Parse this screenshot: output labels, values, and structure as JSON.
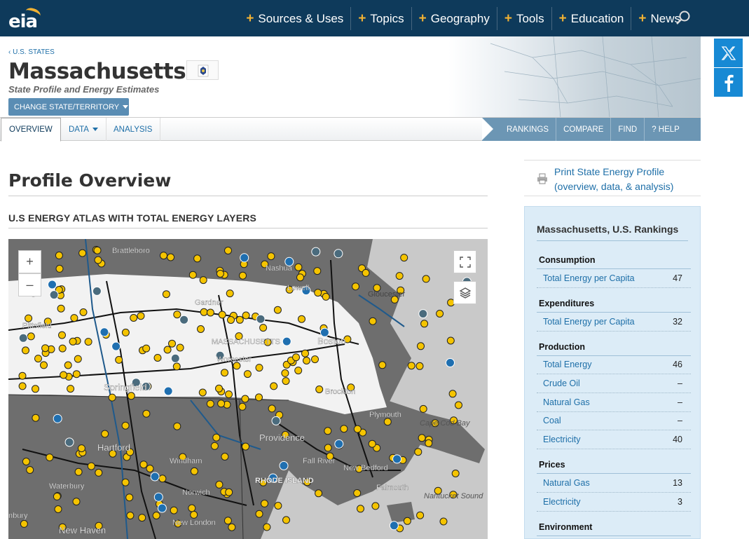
{
  "nav": {
    "logo": "eia",
    "items": [
      {
        "label": "Sources & Uses"
      },
      {
        "label": "Topics"
      },
      {
        "label": "Geography"
      },
      {
        "label": "Tools"
      },
      {
        "label": "Education"
      },
      {
        "label": "News"
      }
    ],
    "plus": "+"
  },
  "header": {
    "breadcrumb": "‹ U.S. STATES",
    "title": "Massachusetts",
    "subtitle": "State Profile and Energy Estimates",
    "change_button": "CHANGE STATE/TERRITORY"
  },
  "tabs": [
    {
      "label": "OVERVIEW"
    },
    {
      "label": "DATA"
    },
    {
      "label": "ANALYSIS"
    }
  ],
  "right_nav": [
    {
      "label": "RANKINGS"
    },
    {
      "label": "COMPARE"
    },
    {
      "label": "FIND"
    },
    {
      "label": "? HELP"
    }
  ],
  "main": {
    "title": "Profile Overview",
    "section": "U.S ENERGY ATLAS WITH TOTAL ENERGY LAYERS"
  },
  "map": {
    "zoom_in": "+",
    "zoom_out": "–",
    "labels": [
      {
        "text": "Brattleboro"
      },
      {
        "text": "Nashua"
      },
      {
        "text": "Lowell"
      },
      {
        "text": "Gloucester"
      },
      {
        "text": "Gardner"
      },
      {
        "text": "Pittsfield"
      },
      {
        "text": "MASSACHUSETTS"
      },
      {
        "text": "Boston"
      },
      {
        "text": "Worcester"
      },
      {
        "text": "Springfield"
      },
      {
        "text": "Brockton"
      },
      {
        "text": "Plymouth"
      },
      {
        "text": "Cape Cod Bay"
      },
      {
        "text": "Hartford"
      },
      {
        "text": "Providence"
      },
      {
        "text": "Windham"
      },
      {
        "text": "Fall River"
      },
      {
        "text": "New Bedford"
      },
      {
        "text": "RHODE ISLAND"
      },
      {
        "text": "Waterbury"
      },
      {
        "text": "Norwich"
      },
      {
        "text": "Falmouth"
      },
      {
        "text": "Nantucket Sound"
      },
      {
        "text": "New London"
      },
      {
        "text": "New Haven"
      },
      {
        "text": "nbury"
      }
    ]
  },
  "sidebar": {
    "print_text": "Print State Energy Profile",
    "print_text2": "(overview, data, & analysis)",
    "rankings_title": "Massachusetts, U.S. Rankings",
    "groups": [
      {
        "name": "Consumption",
        "rows": [
          {
            "label": "Total Energy per Capita",
            "value": "47"
          }
        ]
      },
      {
        "name": "Expenditures",
        "rows": [
          {
            "label": "Total Energy per Capita",
            "value": "32"
          }
        ]
      },
      {
        "name": "Production",
        "rows": [
          {
            "label": "Total Energy",
            "value": "46"
          },
          {
            "label": "Crude Oil",
            "value": "–"
          },
          {
            "label": "Natural Gas",
            "value": "–"
          },
          {
            "label": "Coal",
            "value": "–"
          },
          {
            "label": "Electricity",
            "value": "40"
          }
        ]
      },
      {
        "name": "Prices",
        "rows": [
          {
            "label": "Natural Gas",
            "value": "13"
          },
          {
            "label": "Electricity",
            "value": "3"
          }
        ]
      },
      {
        "name": "Environment",
        "rows": []
      }
    ]
  },
  "colors": {
    "nav_bg": "#0e3a5b",
    "accent": "#f2b233",
    "link": "#1e6fa8",
    "rank_bg": "#dcecf7"
  }
}
